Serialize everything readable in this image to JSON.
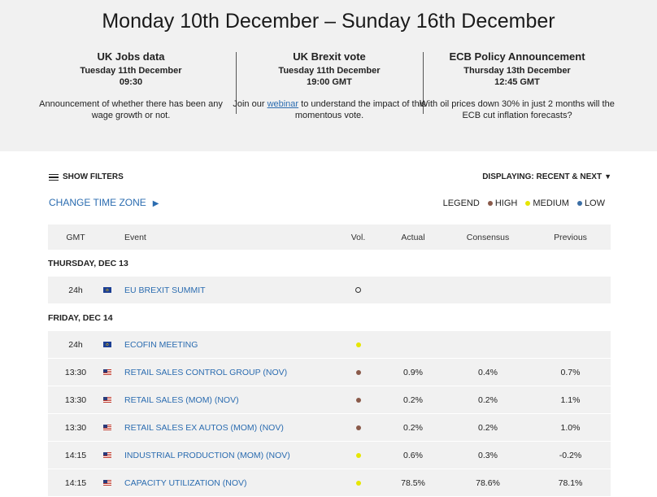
{
  "hero": {
    "title": "Monday 10th December – Sunday 16th December",
    "events": [
      {
        "heading": "UK Jobs data",
        "date": "Tuesday 11th December",
        "time": "09:30",
        "description": "Announcement of whether there has been any wage growth or not."
      },
      {
        "heading": "UK Brexit vote",
        "date": "Tuesday 11th December",
        "time": "19:00 GMT",
        "description_pre": "Join our ",
        "description_link": "webinar",
        "description_post": " to understand the impact of this momentous vote."
      },
      {
        "heading": "ECB Policy Announcement",
        "date": "Thursday 13th December",
        "time": "12:45 GMT",
        "description": "With oil prices down 30% in just 2 months will the ECB cut inflation forecasts?"
      }
    ]
  },
  "controls": {
    "show_filters": "SHOW FILTERS",
    "displaying": "DISPLAYING: RECENT & NEXT",
    "change_timezone": "CHANGE TIME ZONE",
    "legend_label": "LEGEND",
    "legend": [
      {
        "label": "HIGH",
        "color": "#8a5a4a"
      },
      {
        "label": "MEDIUM",
        "color": "#e6e600"
      },
      {
        "label": "LOW",
        "color": "#3b6ea5"
      }
    ]
  },
  "table": {
    "headers": [
      "GMT",
      "Event",
      "Vol.",
      "Actual",
      "Consensus",
      "Previous"
    ],
    "days": [
      {
        "label": "THURSDAY, DEC 13",
        "rows": [
          {
            "time": "24h",
            "flag": "eu",
            "event": "EU BREXIT SUMMIT",
            "vol": "none",
            "actual": "",
            "consensus": "",
            "previous": ""
          }
        ]
      },
      {
        "label": "FRIDAY, DEC 14",
        "rows": [
          {
            "time": "24h",
            "flag": "eu",
            "event": "ECOFIN MEETING",
            "vol": "medium",
            "actual": "",
            "consensus": "",
            "previous": ""
          },
          {
            "time": "13:30",
            "flag": "us",
            "event": "RETAIL SALES CONTROL GROUP (NOV)",
            "vol": "high",
            "actual": "0.9%",
            "consensus": "0.4%",
            "previous": "0.7%"
          },
          {
            "time": "13:30",
            "flag": "us",
            "event": "RETAIL SALES (MOM) (NOV)",
            "vol": "high",
            "actual": "0.2%",
            "consensus": "0.2%",
            "previous": "1.1%"
          },
          {
            "time": "13:30",
            "flag": "us",
            "event": "RETAIL SALES EX AUTOS (MOM) (NOV)",
            "vol": "high",
            "actual": "0.2%",
            "consensus": "0.2%",
            "previous": "1.0%"
          },
          {
            "time": "14:15",
            "flag": "us",
            "event": "INDUSTRIAL PRODUCTION (MOM) (NOV)",
            "vol": "medium",
            "actual": "0.6%",
            "consensus": "0.3%",
            "previous": "-0.2%"
          },
          {
            "time": "14:15",
            "flag": "us",
            "event": "CAPACITY UTILIZATION (NOV)",
            "vol": "medium",
            "actual": "78.5%",
            "consensus": "78.6%",
            "previous": "78.1%"
          }
        ]
      }
    ]
  }
}
